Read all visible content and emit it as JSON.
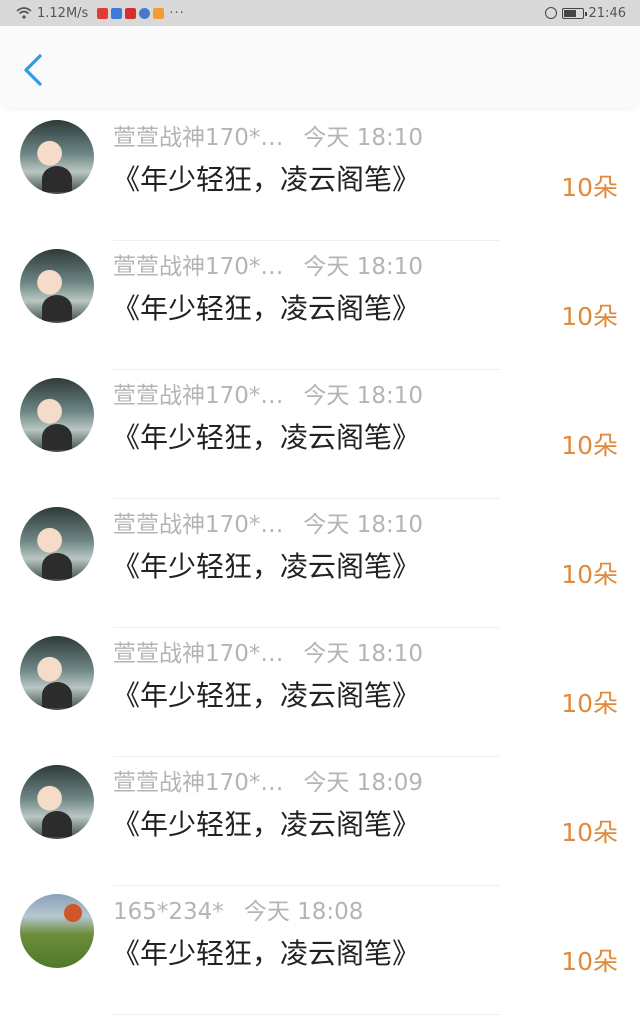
{
  "status_bar": {
    "network_speed": "1.12M/s",
    "more": "···",
    "time": "21:46"
  },
  "header": {
    "back_icon": "chevron-left-icon",
    "accent_color": "#2d9be8"
  },
  "items": [
    {
      "user": "萱萱战神170*…",
      "time": "今天 18:10",
      "title": "《年少轻狂，凌云阁笔》",
      "amount": "10朵",
      "avatar": "girl"
    },
    {
      "user": "萱萱战神170*…",
      "time": "今天 18:10",
      "title": "《年少轻狂，凌云阁笔》",
      "amount": "10朵",
      "avatar": "girl"
    },
    {
      "user": "萱萱战神170*…",
      "time": "今天 18:10",
      "title": "《年少轻狂，凌云阁笔》",
      "amount": "10朵",
      "avatar": "girl"
    },
    {
      "user": "萱萱战神170*…",
      "time": "今天 18:10",
      "title": "《年少轻狂，凌云阁笔》",
      "amount": "10朵",
      "avatar": "girl"
    },
    {
      "user": "萱萱战神170*…",
      "time": "今天 18:10",
      "title": "《年少轻狂，凌云阁笔》",
      "amount": "10朵",
      "avatar": "girl"
    },
    {
      "user": "萱萱战神170*…",
      "time": "今天 18:09",
      "title": "《年少轻狂，凌云阁笔》",
      "amount": "10朵",
      "avatar": "girl"
    },
    {
      "user": "165*234*",
      "time": "今天 18:08",
      "title": "《年少轻狂，凌云阁笔》",
      "amount": "10朵",
      "avatar": "scenery"
    }
  ],
  "colors": {
    "amount": "#e08a3c",
    "meta_text": "#b4b4b4",
    "title_text": "#222222"
  }
}
